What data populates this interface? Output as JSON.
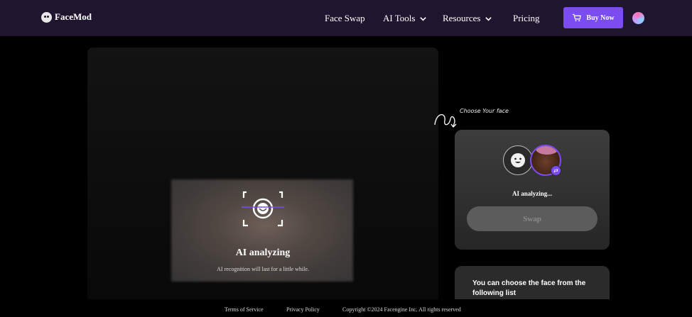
{
  "header": {
    "brand": "FaceMod",
    "nav": [
      {
        "label": "Face Swap",
        "has_dropdown": false
      },
      {
        "label": "AI Tools",
        "has_dropdown": true
      },
      {
        "label": "Resources",
        "has_dropdown": true
      },
      {
        "label": "Pricing",
        "has_dropdown": false
      }
    ],
    "buy_label": "Buy Now",
    "accent": "#7b4cf0",
    "bg": "#20152f"
  },
  "preview": {
    "title": "AI analyzing",
    "subtitle": "AI recognition will last for a little while."
  },
  "side": {
    "hint": "Choose Your face",
    "status": "AI analyzing...",
    "swap_label": "Swap",
    "list_heading": "You can choose the face from the following list"
  },
  "footer": {
    "terms": "Terms of Service",
    "privacy": "Privacy Policy",
    "copyright": "Copyright ©2024  Facengine Inc. All rights reserved"
  }
}
